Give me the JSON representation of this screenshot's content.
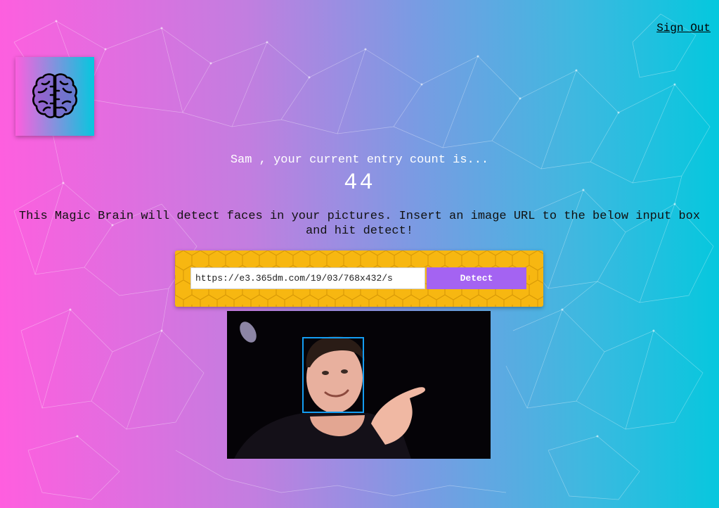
{
  "header": {
    "sign_out_label": "Sign Out"
  },
  "logo": {
    "icon": "brain-icon"
  },
  "rank": {
    "user_name": "Sam",
    "message": "Sam , your current entry count is...",
    "entry_count": "44"
  },
  "intro": {
    "description": "This Magic Brain will detect faces in your pictures. Insert an image URL to the below input box and hit detect!"
  },
  "image_form": {
    "url_value": "https://e3.365dm.com/19/03/768x432/s",
    "detect_label": "Detect"
  },
  "result": {
    "image_alt": "detected face",
    "face_count": 1
  },
  "colors": {
    "gradient_start": "#ff5edf",
    "gradient_end": "#04c8de",
    "form_panel": "#f7b711",
    "detect_button": "#a463f2",
    "bounding_box": "#149df2"
  }
}
